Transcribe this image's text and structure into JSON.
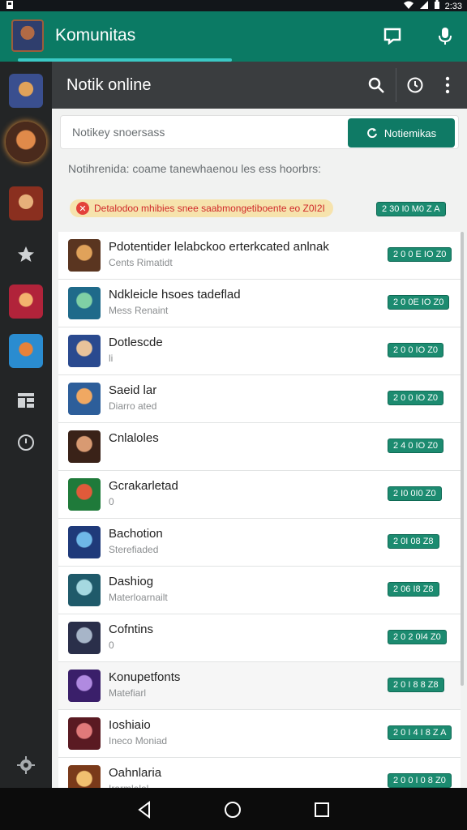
{
  "status_bar": {
    "time": "2:33"
  },
  "app_bar": {
    "title": "Komunitas",
    "icons": [
      "chat-icon",
      "microphone-icon"
    ],
    "accent": "#0b7a64",
    "progress": 0.5
  },
  "sidebar": {
    "items": [
      "avatar-1",
      "avatar-2",
      "avatar-3",
      "star-icon",
      "avatar-4",
      "avatar-5",
      "grid-icon",
      "clock-icon"
    ],
    "bottom_icon": "settings-icon"
  },
  "toolbar": {
    "title": "Notik online",
    "icons": [
      "search-icon",
      "history-icon",
      "more-icon"
    ]
  },
  "search": {
    "placeholder": "Notikey snoersass",
    "button_label": "Notiemikas"
  },
  "description": "Notihrenida: coame tanewhaenou les ess hoorbrs:",
  "notice": {
    "text": "Detalodoo mhibies snee saabmongetiboente eo Z0I2I",
    "badge": "2 30 I0 M0 Z A"
  },
  "list": [
    {
      "name": "Pdotentider lelabckoo erterkcated anlnak",
      "sub": "Cents Rimatidt",
      "badge": "2 0 0 E IO Z0"
    },
    {
      "name": "Ndkleicle hsoes tadeflad",
      "sub": "Mess Renaint",
      "badge": "2 0 0E IO Z0"
    },
    {
      "name": "Dotlescde",
      "sub": "li",
      "badge": "2 0 0 IO Z0"
    },
    {
      "name": "Saeid lar",
      "sub": "Diarro ated",
      "badge": "2 0 0 IO Z0"
    },
    {
      "name": "Cnlaloles",
      "sub": "",
      "badge": "2 4 0 IO Z0"
    },
    {
      "name": "Gcrakarletad",
      "sub": "0",
      "badge": "2 I0 0I0 Z0"
    },
    {
      "name": "Bachotion",
      "sub": "Sterefiaded",
      "badge": "2 0I 08 Z8"
    },
    {
      "name": "Dashiog",
      "sub": "Materloarnailt",
      "badge": "2 06 I8 Z8"
    },
    {
      "name": "Cofntins",
      "sub": "0",
      "badge": "2 0 2 0I4 Z0"
    },
    {
      "name": "Konupetfonts",
      "sub": "Matefiarl",
      "badge": "2 0 I 8 8 Z8"
    },
    {
      "name": "Ioshiaio",
      "sub": "Ineco Moniad",
      "badge": "2 0 I 4 I 8 Z A"
    },
    {
      "name": "Oahnlaria",
      "sub": "Irarmlelol",
      "badge": "2 0 0 I 0 8 Z0"
    }
  ],
  "nav_bar": {
    "icons": [
      "back-icon",
      "home-icon",
      "recents-icon"
    ]
  }
}
